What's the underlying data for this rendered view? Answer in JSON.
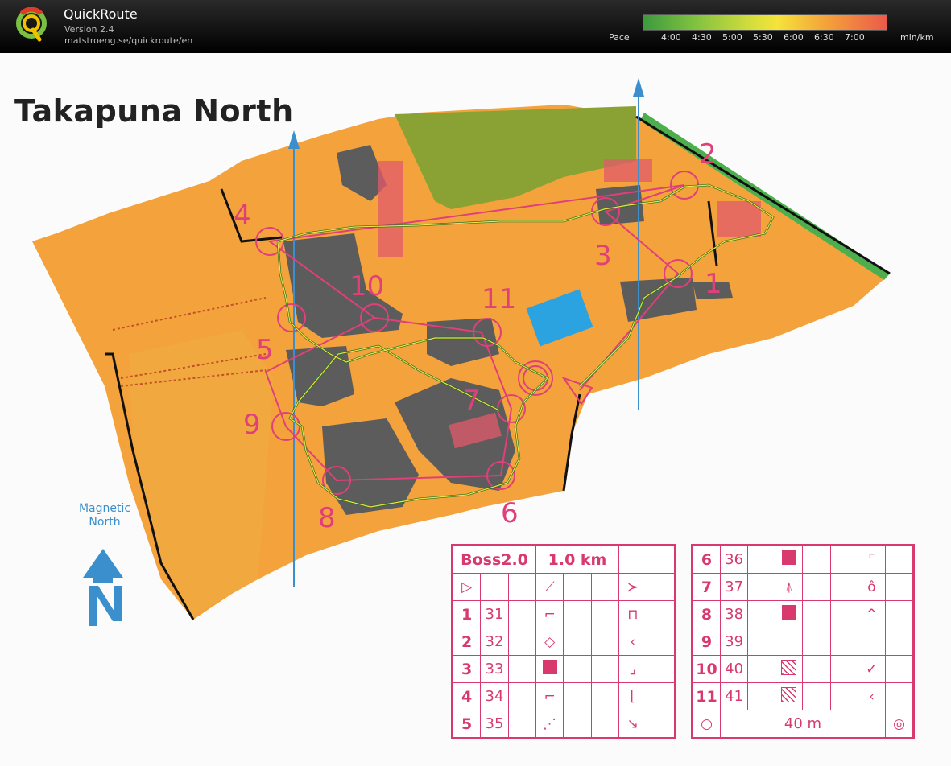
{
  "app": {
    "title": "QuickRoute",
    "version": "Version 2.4",
    "url": "matstroeng.se/quickroute/en"
  },
  "pace_legend": {
    "label": "Pace",
    "ticks": [
      "4:00",
      "4:30",
      "5:00",
      "5:30",
      "6:00",
      "6:30",
      "7:00"
    ],
    "unit": "min/km",
    "colors": [
      "#4aa83a",
      "#8cc43e",
      "#d4dc3a",
      "#f4e23a",
      "#f4a43a",
      "#ec6a4a"
    ]
  },
  "map": {
    "title": "Takapuna North",
    "magnetic_north_label": [
      "Magnetic",
      "North"
    ],
    "route_color": "#e0407a",
    "track_colors": [
      "#1f6e1f",
      "#f0e04a"
    ],
    "controls": [
      {
        "label": "1"
      },
      {
        "label": "2"
      },
      {
        "label": "3"
      },
      {
        "label": "4"
      },
      {
        "label": "5"
      },
      {
        "label": "6"
      },
      {
        "label": "7"
      },
      {
        "label": "8"
      },
      {
        "label": "9"
      },
      {
        "label": "10"
      },
      {
        "label": "11"
      }
    ]
  },
  "description_sheet": {
    "event": "Boss2.0",
    "length": "1.0 km",
    "rows_left": [
      {
        "num": "1",
        "code": "31"
      },
      {
        "num": "2",
        "code": "32"
      },
      {
        "num": "3",
        "code": "33"
      },
      {
        "num": "4",
        "code": "34"
      },
      {
        "num": "5",
        "code": "35"
      }
    ],
    "rows_right": [
      {
        "num": "6",
        "code": "36"
      },
      {
        "num": "7",
        "code": "37"
      },
      {
        "num": "8",
        "code": "38"
      },
      {
        "num": "9",
        "code": "39"
      },
      {
        "num": "10",
        "code": "40"
      },
      {
        "num": "11",
        "code": "41"
      }
    ],
    "finish": "40 m"
  }
}
